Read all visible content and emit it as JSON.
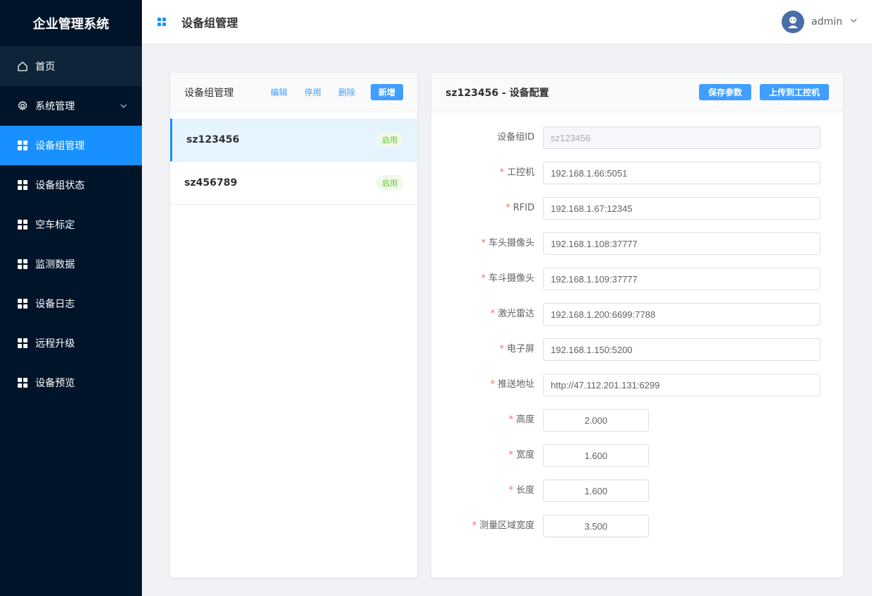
{
  "app": {
    "title": "企业管理系统"
  },
  "sidebar": {
    "items": [
      {
        "label": "首页",
        "icon": "home-icon"
      },
      {
        "label": "系统管理",
        "icon": "gear-icon"
      },
      {
        "label": "设备组管理",
        "icon": "grid-icon",
        "active": true
      },
      {
        "label": "设备组状态",
        "icon": "grid-icon"
      },
      {
        "label": "空车标定",
        "icon": "grid-icon"
      },
      {
        "label": "监测数据",
        "icon": "grid-icon"
      },
      {
        "label": "设备日志",
        "icon": "grid-icon"
      },
      {
        "label": "远程升级",
        "icon": "grid-icon"
      },
      {
        "label": "设备预览",
        "icon": "grid-icon"
      }
    ]
  },
  "header": {
    "title": "设备组管理",
    "username": "admin"
  },
  "left_panel": {
    "title": "设备组管理",
    "actions": {
      "edit": "编辑",
      "disable": "停用",
      "delete": "删除",
      "add": "新增"
    },
    "groups": [
      {
        "name": "sz123456",
        "status": "启用",
        "selected": true
      },
      {
        "name": "sz456789",
        "status": "启用",
        "selected": false
      }
    ]
  },
  "right_panel": {
    "title": "sz123456 - 设备配置",
    "actions": {
      "save": "保存参数",
      "upload": "上传到工控机"
    },
    "fields": [
      {
        "label": "设备组ID",
        "value": "sz123456",
        "required": false
      },
      {
        "label": "工控机",
        "value": "192.168.1.66:5051",
        "required": true
      },
      {
        "label": "RFID",
        "value": "192.168.1.67:12345",
        "required": true
      },
      {
        "label": "车头摄像头",
        "value": "192.168.1.108:37777",
        "required": true
      },
      {
        "label": "车斗摄像头",
        "value": "192.168.1.109:37777",
        "required": true
      },
      {
        "label": "激光雷达",
        "value": "192.168.1.200:6699:7788",
        "required": true
      },
      {
        "label": "电子屏",
        "value": "192.168.1.150:5200",
        "required": true
      },
      {
        "label": "推送地址",
        "value": "http://47.112.201.131:6299",
        "required": true
      },
      {
        "label": "高度",
        "value": "2.000",
        "required": true
      },
      {
        "label": "宽度",
        "value": "1.600",
        "required": true
      },
      {
        "label": "长度",
        "value": "1.600",
        "required": true
      },
      {
        "label": "测量区域宽度",
        "value": "3.500",
        "required": true
      }
    ]
  },
  "colors": {
    "sidebar_bg": "#001529",
    "active": "#1890ff",
    "primary": "#409eff",
    "required": "#f56c6c",
    "tag_green": "#67c23a"
  }
}
